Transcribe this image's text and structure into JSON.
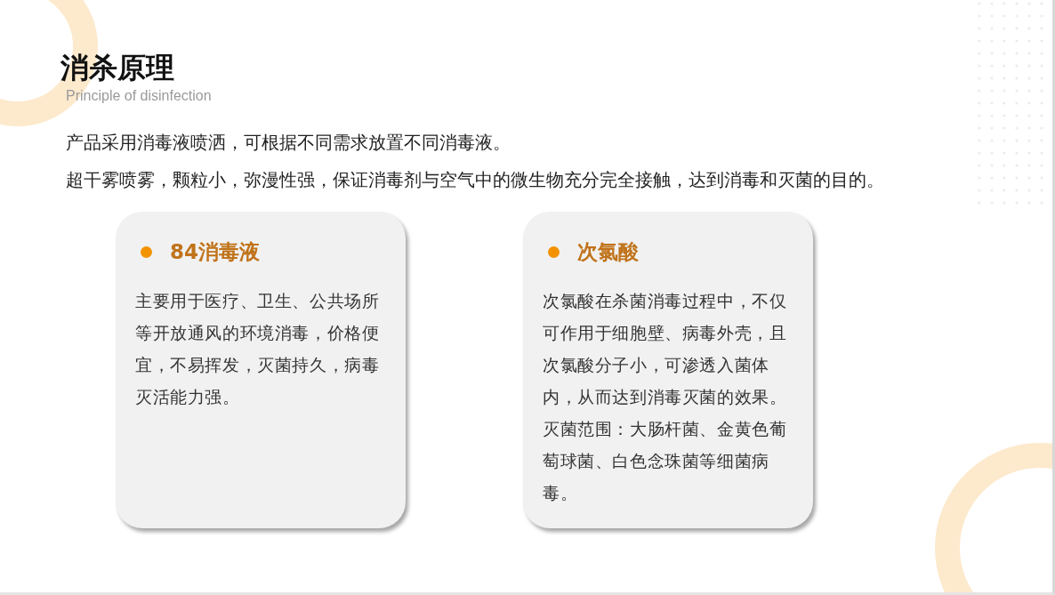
{
  "title": "消杀原理",
  "subtitle": "Principle of disinfection",
  "intro": [
    "产品采用消毒液喷洒，可根据不同需求放置不同消毒液。",
    "超干雾喷雾，颗粒小，弥漫性强，保证消毒剂与空气中的微生物充分完全接触，达到消毒和灭菌的目的。"
  ],
  "cards": [
    {
      "title": "84消毒液",
      "body": "主要用于医疗、卫生、公共场所等开放通风的环境消毒，价格便宜，不易挥发，灭菌持久，病毒灭活能力强。"
    },
    {
      "title": "次氯酸",
      "body": "次氯酸在杀菌消毒过程中，不仅可作用于细胞壁、病毒外壳，且次氯酸分子小，可渗透入菌体内，从而达到消毒灭菌的效果。灭菌范围：大肠杆菌、金黄色葡萄球菌、白色念珠菌等细菌病毒。"
    }
  ]
}
